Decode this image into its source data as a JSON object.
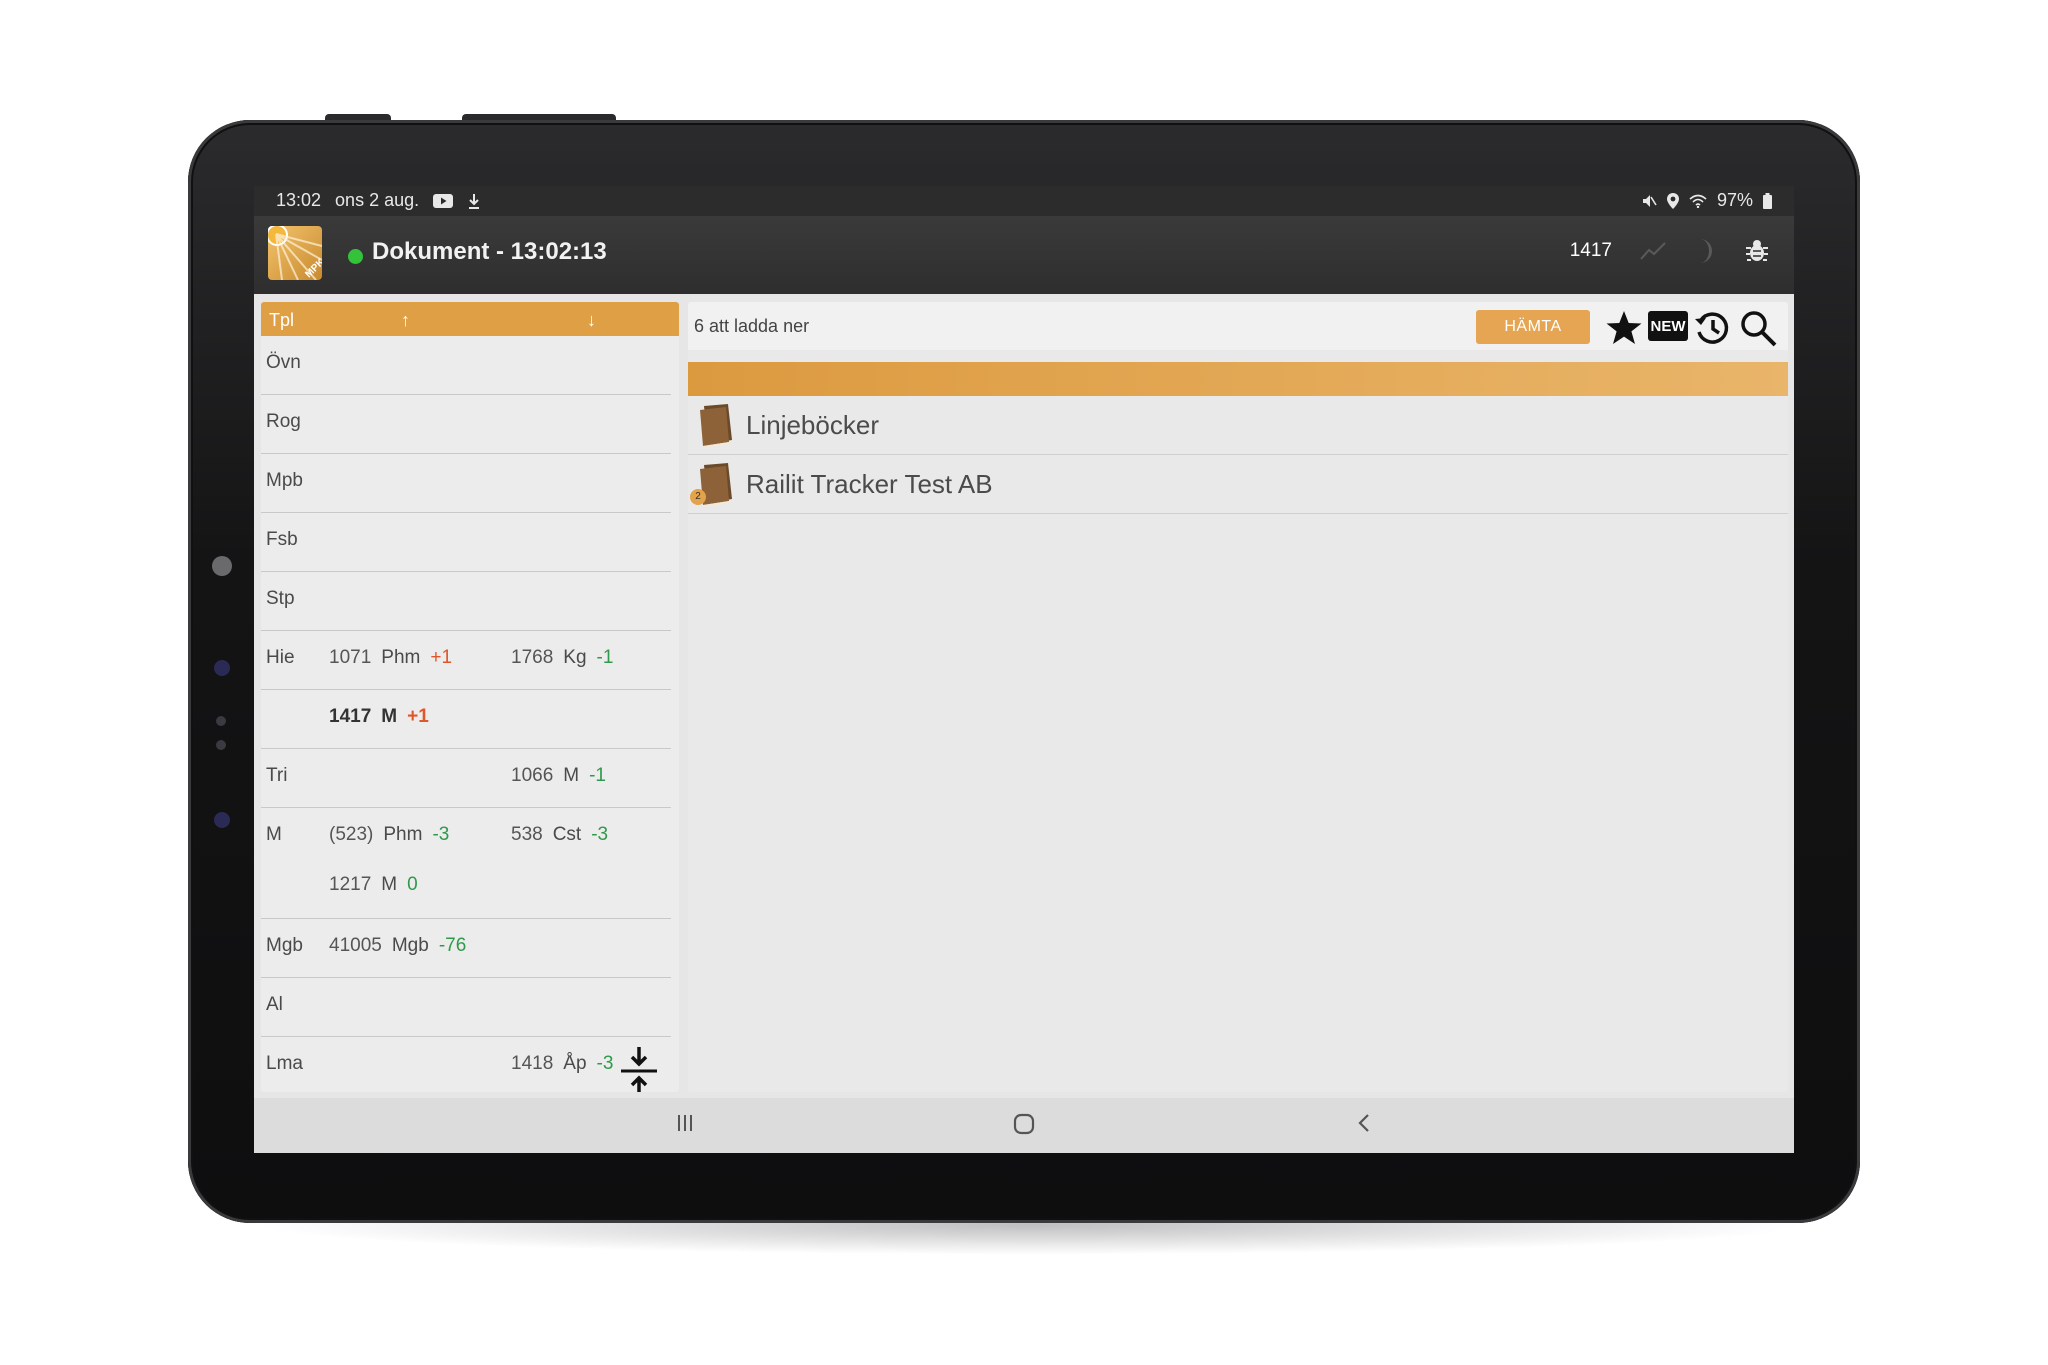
{
  "status_bar": {
    "time": "13:02",
    "date": "ons 2 aug.",
    "battery": "97%",
    "icons": [
      "youtube-icon",
      "download-icon",
      "mute-icon",
      "location-icon",
      "wifi-icon",
      "battery-icon"
    ]
  },
  "app_bar": {
    "status_color": "#33c23a",
    "title": "Dokument - 13:02:13",
    "train_number": "1417",
    "icons": [
      "chart-icon",
      "moon-icon",
      "bug-icon"
    ]
  },
  "left_panel": {
    "header": {
      "label": "Tpl",
      "up_arrow": "↑",
      "down_arrow": "↓"
    },
    "rows": [
      {
        "tpl": "Övn"
      },
      {
        "tpl": "Rog"
      },
      {
        "tpl": "Mpb"
      },
      {
        "tpl": "Fsb"
      },
      {
        "tpl": "Stp"
      },
      {
        "tpl": "Hie",
        "a": {
          "num": "1071",
          "code": "Phm",
          "delta": "+1"
        },
        "b": {
          "num": "1768",
          "code": "Kg",
          "delta": "-1"
        }
      },
      {
        "tpl": "",
        "a": {
          "num": "1417",
          "code": "M",
          "delta": "+1"
        }
      },
      {
        "tpl": "Tri",
        "b": {
          "num": "1066",
          "code": "M",
          "delta": "-1"
        }
      },
      {
        "tpl": "M",
        "a": {
          "num": "(523)",
          "code": "Phm",
          "delta": "-3"
        },
        "b": {
          "num": "538",
          "code": "Cst",
          "delta": "-3"
        },
        "c": {
          "num": "1217",
          "code": "M",
          "delta": "0"
        }
      },
      {
        "tpl": "Mgb",
        "a": {
          "num": "41005",
          "code": "Mgb",
          "delta": "-76"
        }
      },
      {
        "tpl": "Al"
      },
      {
        "tpl": "Lma",
        "b": {
          "num": "1418",
          "code": "Åp",
          "delta": "-3"
        }
      }
    ]
  },
  "right_panel": {
    "download_status": "6 att ladda ner",
    "fetch_button": "HÄMTA",
    "new_badge": "NEW",
    "documents": [
      {
        "label": "Linjeböcker",
        "badge": ""
      },
      {
        "label": "Railit Tracker Test AB",
        "badge": "2"
      }
    ]
  },
  "nav_bar": {
    "icons": [
      "recents-icon",
      "home-icon",
      "back-icon"
    ]
  },
  "colors": {
    "accent": "#df9f45",
    "positive_delta": "#e0562b",
    "negative_delta": "#2f9a4b"
  }
}
